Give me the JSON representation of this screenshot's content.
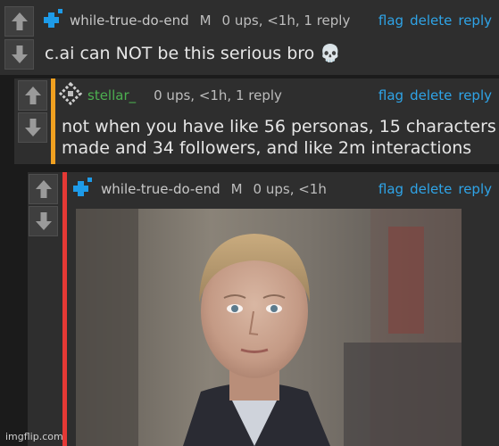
{
  "comments": [
    {
      "username": "while-true-do-end",
      "badge": "M",
      "meta": "0 ups, <1h, 1 reply",
      "actions": [
        "flag",
        "delete",
        "reply"
      ],
      "text": "c.ai can NOT be this serious bro 💀",
      "username_color": "#c8c8c8",
      "accent_color": "none"
    },
    {
      "username": "stellar_",
      "meta": "0 ups, <1h, 1 reply",
      "actions": [
        "flag",
        "delete",
        "reply"
      ],
      "text_line1": "not when you have like 56 personas, 15 characters",
      "text_line2": "made and 34 followers, and like 2m interactions",
      "username_color": "#4caf50",
      "accent_color": "#f0a020"
    },
    {
      "username": "while-true-do-end",
      "badge": "M",
      "meta": "0 ups, <1h",
      "actions": [
        "flag",
        "delete",
        "reply"
      ],
      "accent_color": "#e53935"
    }
  ],
  "watermark": "imgflip.com",
  "colors": {
    "link": "#2fa4e7",
    "background": "#1b1b1b",
    "panel": "#2e2e2e"
  }
}
